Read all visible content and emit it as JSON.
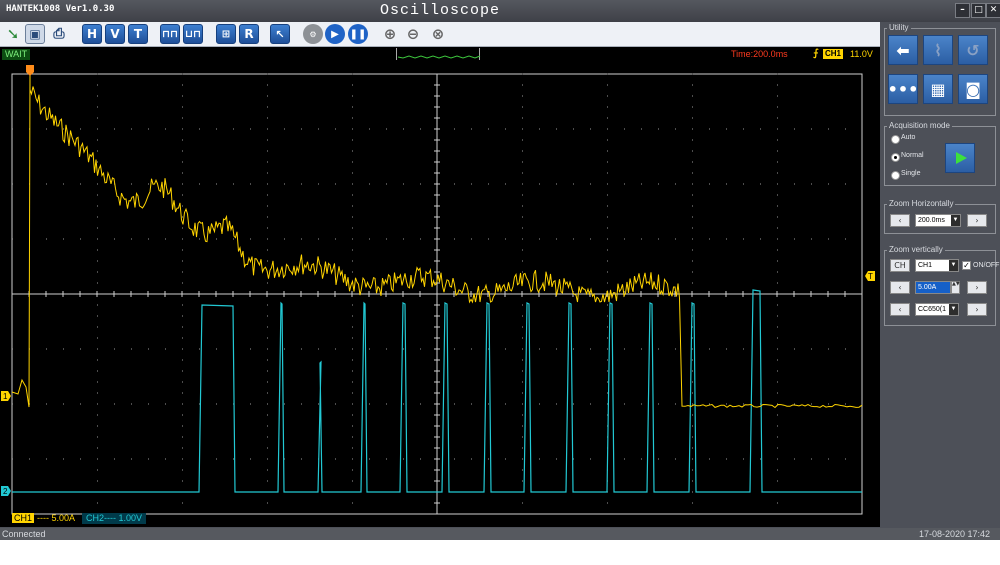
{
  "app": {
    "name": "HANTEK1008 Ver1.0.30",
    "title": "Oscilloscope"
  },
  "window_controls": {
    "minimize": "–",
    "maximize": "□",
    "close": "✕"
  },
  "toolbar": {
    "icons": [
      "open-icon",
      "save-icon",
      "print-icon",
      "h-icon",
      "v-icon",
      "t-icon",
      "pulse-icon",
      "pulse-alt-icon",
      "measure-icon",
      "r-icon",
      "cursor-icon",
      "autoset-icon",
      "run-icon",
      "pause-icon",
      "zoom-in-icon",
      "zoom-out-icon",
      "zoom-reset-icon"
    ],
    "h": "H",
    "v": "V",
    "t": "T",
    "r": "R"
  },
  "status": {
    "state": "WAIT",
    "timebase": "Time:200.0ms",
    "trigger_channel": "CH1",
    "trigger_level": "11.0V"
  },
  "markers": {
    "ch1": "1",
    "ch2": "2",
    "trigger": "T"
  },
  "channels": [
    {
      "label": "CH1",
      "coupling": "----",
      "scale": "5.00A",
      "color": "#ffd400"
    },
    {
      "label": "CH2",
      "coupling": "----",
      "scale": "1.00V",
      "color": "#22c9d4"
    }
  ],
  "footer": {
    "connection": "Connected",
    "datetime": "17-08-2020 17:42"
  },
  "utility": {
    "title": "Utility"
  },
  "acquisition": {
    "title": "Acquisition mode",
    "options": [
      "Auto",
      "Normal",
      "Single"
    ],
    "selected": "Normal"
  },
  "zoom_h": {
    "title": "Zoom Horizontally",
    "value": "200.0ms"
  },
  "zoom_v": {
    "title": "Zoom vertically",
    "channel": "CH1",
    "channel_button": "CH",
    "onoff": "ON/OFF",
    "scale": "5.00A",
    "probe": "CC650(1"
  },
  "colors": {
    "ch1": "#ffd400",
    "ch2": "#22c9d4",
    "grid": "#9a9a9a",
    "accent": "#2b5ea4"
  }
}
